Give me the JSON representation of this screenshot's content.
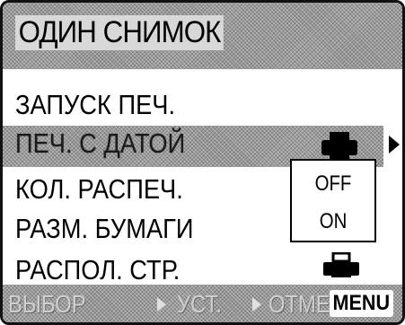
{
  "title": "ОДИН СНИМОК",
  "menu": {
    "items": [
      {
        "label": "ЗАПУСК ПЕЧ."
      },
      {
        "label": "ПЕЧ. С ДАТОЙ"
      },
      {
        "label": "КОЛ. РАСПЕЧ."
      },
      {
        "label": "РАЗМ. БУМАГИ"
      },
      {
        "label": "РАСПОЛ. СТР."
      }
    ],
    "selected_index": 1
  },
  "dropdown": {
    "options": [
      "OFF",
      "ON"
    ]
  },
  "bottom_bar": {
    "select_hint": "ВЫБОР",
    "set_hint": "УСТ.",
    "cancel_hint": "ОТМЕН",
    "menu_label": "MENU"
  },
  "icons": {
    "selected_value": "printer-icon",
    "layout_value": "printer-icon",
    "submenu": "arrow-right-icon"
  }
}
